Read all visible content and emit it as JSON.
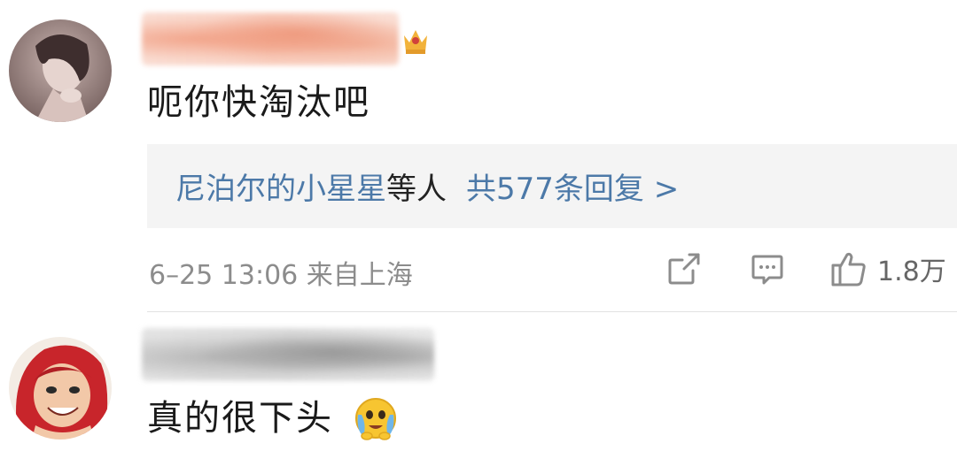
{
  "comments": [
    {
      "username": "",
      "text": "呃你快淘汰吧",
      "reply_preview": {
        "user": "尼泊尔的小星星",
        "suffix": "等人",
        "count_label": "共577条回复 >"
      },
      "time": "6–25 13:06 来自上海",
      "likes": "1.8万",
      "icons": [
        "share-icon",
        "comment-icon",
        "like-icon"
      ]
    },
    {
      "username": "",
      "text": "真的很下头",
      "emoji": "crying-face-emoji"
    }
  ],
  "colors": {
    "link": "#4c79a8",
    "meta": "#8c8c8c",
    "reply_bg": "#f4f4f4"
  }
}
